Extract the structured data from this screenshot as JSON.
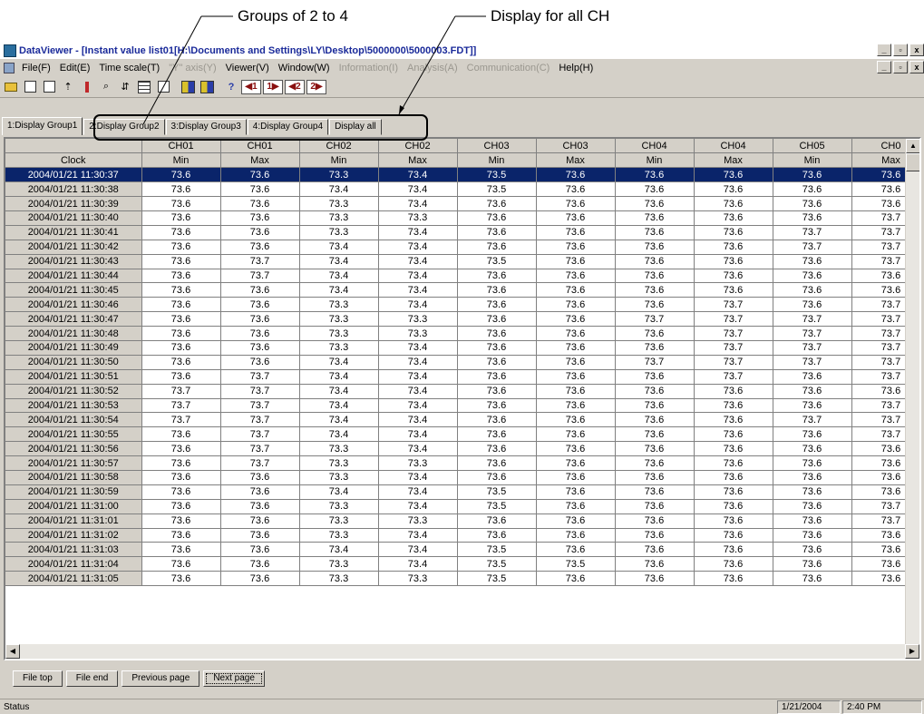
{
  "callouts": {
    "groups_label": "Groups of 2 to 4",
    "display_all_label": "Display for all CH"
  },
  "window": {
    "title": "DataViewer - [Instant value list01[H:\\Documents and Settings\\LY\\Desktop\\5000000\\5000003.FDT]]"
  },
  "menu": [
    {
      "label": "File(F)",
      "enabled": true
    },
    {
      "label": "Edit(E)",
      "enabled": true
    },
    {
      "label": "Time scale(T)",
      "enabled": true
    },
    {
      "label": "\"Y\" axis(Y)",
      "enabled": false
    },
    {
      "label": "Viewer(V)",
      "enabled": true
    },
    {
      "label": "Window(W)",
      "enabled": true
    },
    {
      "label": "Information(I)",
      "enabled": false
    },
    {
      "label": "Analysis(A)",
      "enabled": false
    },
    {
      "label": "Communication(C)",
      "enabled": false
    },
    {
      "label": "Help(H)",
      "enabled": true
    }
  ],
  "toolbar": {
    "nav1": "1",
    "nav2": "1",
    "nav3": "2",
    "nav4": "2"
  },
  "tabs": [
    {
      "label": "1:Display Group1",
      "active": true
    },
    {
      "label": "2:Display Group2",
      "active": false
    },
    {
      "label": "3:Display Group3",
      "active": false
    },
    {
      "label": "4:Display Group4",
      "active": false
    },
    {
      "label": "Display all",
      "active": false
    }
  ],
  "table": {
    "channel_header": [
      "CH01",
      "CH01",
      "CH02",
      "CH02",
      "CH03",
      "CH03",
      "CH04",
      "CH04",
      "CH05",
      "CH0"
    ],
    "clock_header": "Clock",
    "stat_header": [
      "Min",
      "Max",
      "Min",
      "Max",
      "Min",
      "Max",
      "Min",
      "Max",
      "Min",
      "Max"
    ],
    "rows": [
      {
        "clock": "2004/01/21 11:30:37",
        "values": [
          "73.6",
          "73.6",
          "73.3",
          "73.4",
          "73.5",
          "73.6",
          "73.6",
          "73.6",
          "73.6",
          "73.6"
        ],
        "selected": true
      },
      {
        "clock": "2004/01/21 11:30:38",
        "values": [
          "73.6",
          "73.6",
          "73.4",
          "73.4",
          "73.5",
          "73.6",
          "73.6",
          "73.6",
          "73.6",
          "73.6"
        ]
      },
      {
        "clock": "2004/01/21 11:30:39",
        "values": [
          "73.6",
          "73.6",
          "73.3",
          "73.4",
          "73.6",
          "73.6",
          "73.6",
          "73.6",
          "73.6",
          "73.6"
        ]
      },
      {
        "clock": "2004/01/21 11:30:40",
        "values": [
          "73.6",
          "73.6",
          "73.3",
          "73.3",
          "73.6",
          "73.6",
          "73.6",
          "73.6",
          "73.6",
          "73.7"
        ]
      },
      {
        "clock": "2004/01/21 11:30:41",
        "values": [
          "73.6",
          "73.6",
          "73.3",
          "73.4",
          "73.6",
          "73.6",
          "73.6",
          "73.6",
          "73.7",
          "73.7"
        ]
      },
      {
        "clock": "2004/01/21 11:30:42",
        "values": [
          "73.6",
          "73.6",
          "73.4",
          "73.4",
          "73.6",
          "73.6",
          "73.6",
          "73.6",
          "73.7",
          "73.7"
        ]
      },
      {
        "clock": "2004/01/21 11:30:43",
        "values": [
          "73.6",
          "73.7",
          "73.4",
          "73.4",
          "73.5",
          "73.6",
          "73.6",
          "73.6",
          "73.6",
          "73.7"
        ]
      },
      {
        "clock": "2004/01/21 11:30:44",
        "values": [
          "73.6",
          "73.7",
          "73.4",
          "73.4",
          "73.6",
          "73.6",
          "73.6",
          "73.6",
          "73.6",
          "73.6"
        ]
      },
      {
        "clock": "2004/01/21 11:30:45",
        "values": [
          "73.6",
          "73.6",
          "73.4",
          "73.4",
          "73.6",
          "73.6",
          "73.6",
          "73.6",
          "73.6",
          "73.6"
        ]
      },
      {
        "clock": "2004/01/21 11:30:46",
        "values": [
          "73.6",
          "73.6",
          "73.3",
          "73.4",
          "73.6",
          "73.6",
          "73.6",
          "73.7",
          "73.6",
          "73.7"
        ]
      },
      {
        "clock": "2004/01/21 11:30:47",
        "values": [
          "73.6",
          "73.6",
          "73.3",
          "73.3",
          "73.6",
          "73.6",
          "73.7",
          "73.7",
          "73.7",
          "73.7"
        ]
      },
      {
        "clock": "2004/01/21 11:30:48",
        "values": [
          "73.6",
          "73.6",
          "73.3",
          "73.3",
          "73.6",
          "73.6",
          "73.6",
          "73.7",
          "73.7",
          "73.7"
        ]
      },
      {
        "clock": "2004/01/21 11:30:49",
        "values": [
          "73.6",
          "73.6",
          "73.3",
          "73.4",
          "73.6",
          "73.6",
          "73.6",
          "73.7",
          "73.7",
          "73.7"
        ]
      },
      {
        "clock": "2004/01/21 11:30:50",
        "values": [
          "73.6",
          "73.6",
          "73.4",
          "73.4",
          "73.6",
          "73.6",
          "73.7",
          "73.7",
          "73.7",
          "73.7"
        ]
      },
      {
        "clock": "2004/01/21 11:30:51",
        "values": [
          "73.6",
          "73.7",
          "73.4",
          "73.4",
          "73.6",
          "73.6",
          "73.6",
          "73.7",
          "73.6",
          "73.7"
        ]
      },
      {
        "clock": "2004/01/21 11:30:52",
        "values": [
          "73.7",
          "73.7",
          "73.4",
          "73.4",
          "73.6",
          "73.6",
          "73.6",
          "73.6",
          "73.6",
          "73.6"
        ]
      },
      {
        "clock": "2004/01/21 11:30:53",
        "values": [
          "73.7",
          "73.7",
          "73.4",
          "73.4",
          "73.6",
          "73.6",
          "73.6",
          "73.6",
          "73.6",
          "73.7"
        ]
      },
      {
        "clock": "2004/01/21 11:30:54",
        "values": [
          "73.7",
          "73.7",
          "73.4",
          "73.4",
          "73.6",
          "73.6",
          "73.6",
          "73.6",
          "73.7",
          "73.7"
        ]
      },
      {
        "clock": "2004/01/21 11:30:55",
        "values": [
          "73.6",
          "73.7",
          "73.4",
          "73.4",
          "73.6",
          "73.6",
          "73.6",
          "73.6",
          "73.6",
          "73.7"
        ]
      },
      {
        "clock": "2004/01/21 11:30:56",
        "values": [
          "73.6",
          "73.7",
          "73.3",
          "73.4",
          "73.6",
          "73.6",
          "73.6",
          "73.6",
          "73.6",
          "73.6"
        ]
      },
      {
        "clock": "2004/01/21 11:30:57",
        "values": [
          "73.6",
          "73.7",
          "73.3",
          "73.3",
          "73.6",
          "73.6",
          "73.6",
          "73.6",
          "73.6",
          "73.6"
        ]
      },
      {
        "clock": "2004/01/21 11:30:58",
        "values": [
          "73.6",
          "73.6",
          "73.3",
          "73.4",
          "73.6",
          "73.6",
          "73.6",
          "73.6",
          "73.6",
          "73.6"
        ]
      },
      {
        "clock": "2004/01/21 11:30:59",
        "values": [
          "73.6",
          "73.6",
          "73.4",
          "73.4",
          "73.5",
          "73.6",
          "73.6",
          "73.6",
          "73.6",
          "73.6"
        ]
      },
      {
        "clock": "2004/01/21 11:31:00",
        "values": [
          "73.6",
          "73.6",
          "73.3",
          "73.4",
          "73.5",
          "73.6",
          "73.6",
          "73.6",
          "73.6",
          "73.7"
        ]
      },
      {
        "clock": "2004/01/21 11:31:01",
        "values": [
          "73.6",
          "73.6",
          "73.3",
          "73.3",
          "73.6",
          "73.6",
          "73.6",
          "73.6",
          "73.6",
          "73.7"
        ]
      },
      {
        "clock": "2004/01/21 11:31:02",
        "values": [
          "73.6",
          "73.6",
          "73.3",
          "73.4",
          "73.6",
          "73.6",
          "73.6",
          "73.6",
          "73.6",
          "73.6"
        ]
      },
      {
        "clock": "2004/01/21 11:31:03",
        "values": [
          "73.6",
          "73.6",
          "73.4",
          "73.4",
          "73.5",
          "73.6",
          "73.6",
          "73.6",
          "73.6",
          "73.6"
        ]
      },
      {
        "clock": "2004/01/21 11:31:04",
        "values": [
          "73.6",
          "73.6",
          "73.3",
          "73.4",
          "73.5",
          "73.5",
          "73.6",
          "73.6",
          "73.6",
          "73.6"
        ]
      },
      {
        "clock": "2004/01/21 11:31:05",
        "values": [
          "73.6",
          "73.6",
          "73.3",
          "73.3",
          "73.5",
          "73.6",
          "73.6",
          "73.6",
          "73.6",
          "73.6"
        ]
      }
    ]
  },
  "buttons": {
    "file_top": "File top",
    "file_end": "File end",
    "previous_page": "Previous page",
    "next_page": "Next page"
  },
  "status": {
    "text": "Status",
    "date": "1/21/2004",
    "time": "2:40 PM"
  },
  "colors": {
    "selection": "#0a246a",
    "face": "#d4d0c8"
  }
}
